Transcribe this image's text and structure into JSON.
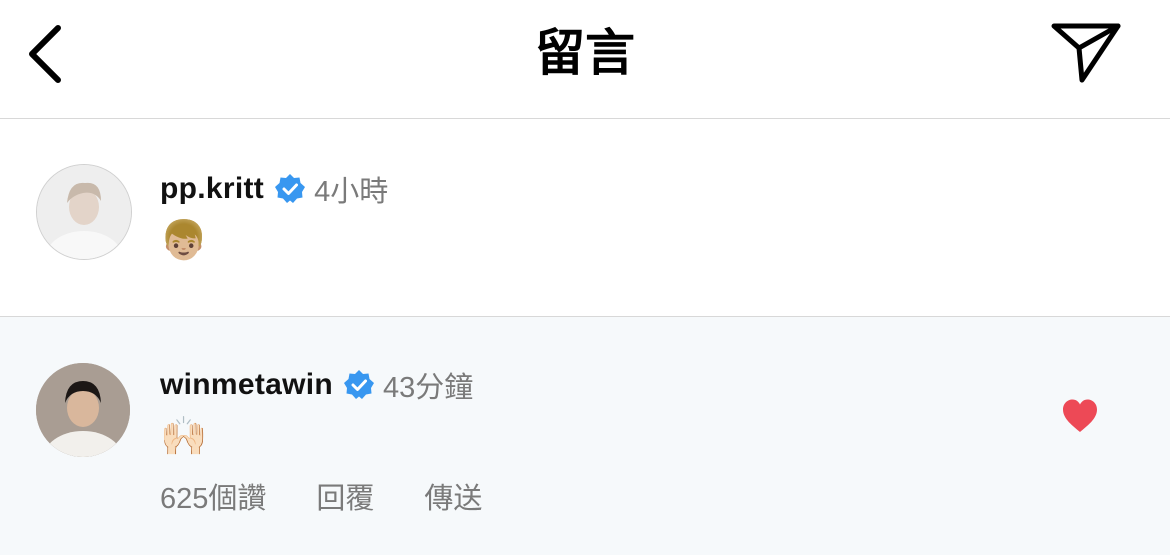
{
  "header": {
    "title": "留言",
    "back_icon": "chevron-left-icon",
    "share_icon": "paper-plane-icon"
  },
  "comments": [
    {
      "username": "pp.kritt",
      "verified": true,
      "time": "4小時",
      "text": "👦🏼"
    },
    {
      "username": "winmetawin",
      "verified": true,
      "time": "43分鐘",
      "text": "🙌🏻",
      "likes_label": "625個讚",
      "reply_label": "回覆",
      "send_label": "傳送",
      "liked": true
    }
  ],
  "colors": {
    "verified_badge": "#3897f0",
    "heart": "#ed4956",
    "secondary_text": "#7a7a7a",
    "highlight_bg": "#f6f9fb"
  }
}
